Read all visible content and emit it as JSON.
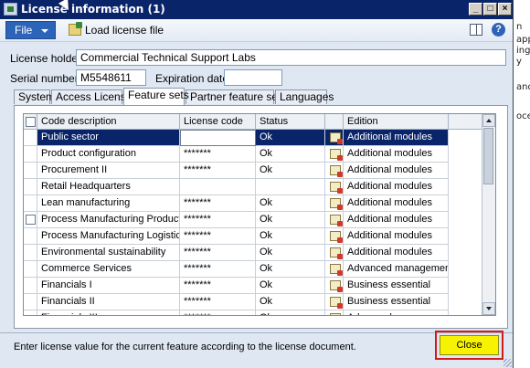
{
  "window": {
    "title": "License information (1)"
  },
  "toolbar": {
    "file_label": "File",
    "load_label": "Load license file"
  },
  "fields": {
    "holder_label": "License holder:",
    "holder_value": "Commercial Technical Support Labs",
    "serial_label": "Serial number:",
    "serial_value": "M5548611",
    "expiration_label": "Expiration date:",
    "expiration_value": ""
  },
  "tabs": [
    "System",
    "Access Licenses",
    "Feature sets",
    "Partner feature sets",
    "Languages"
  ],
  "active_tab": "Feature sets",
  "grid": {
    "headers": {
      "code": "Code description",
      "license": "License code",
      "status": "Status",
      "edition": "Edition"
    },
    "rows": [
      {
        "code": "Public sector",
        "license": "",
        "status": "Ok",
        "edition": "Additional modules",
        "selected": true,
        "checkbox": false
      },
      {
        "code": "Product configuration",
        "license": "*******",
        "status": "Ok",
        "edition": "Additional modules"
      },
      {
        "code": "Procurement II",
        "license": "*******",
        "status": "Ok",
        "edition": "Additional modules"
      },
      {
        "code": "Retail Headquarters",
        "license": "",
        "status": "",
        "edition": "Additional modules"
      },
      {
        "code": "Lean manufacturing",
        "license": "*******",
        "status": "Ok",
        "edition": "Additional modules"
      },
      {
        "code": "Process Manufacturing Production",
        "license": "*******",
        "status": "Ok",
        "edition": "Additional modules",
        "checkbox": true
      },
      {
        "code": "Process Manufacturing Logistics",
        "license": "*******",
        "status": "Ok",
        "edition": "Additional modules"
      },
      {
        "code": "Environmental sustainability",
        "license": "*******",
        "status": "Ok",
        "edition": "Additional modules"
      },
      {
        "code": "Commerce Services",
        "license": "*******",
        "status": "Ok",
        "edition": "Advanced management"
      },
      {
        "code": "Financials I",
        "license": "*******",
        "status": "Ok",
        "edition": "Business essential"
      },
      {
        "code": "Financials II",
        "license": "*******",
        "status": "Ok",
        "edition": "Business essential"
      },
      {
        "code": "Financials III",
        "license": "*******",
        "status": "Ok",
        "edition": "Advanced management"
      }
    ]
  },
  "status_bar": {
    "message": "Enter license value for the current feature according to the license document."
  },
  "buttons": {
    "close": "Close"
  },
  "background_fragments": [
    "n",
    "app",
    "ing",
    "y",
    "and",
    "oce"
  ],
  "colors": {
    "title_bar": "#0a246a",
    "selection": "#0a246a",
    "close_button": "#f7f200",
    "highlight_box": "#d21a1a"
  }
}
